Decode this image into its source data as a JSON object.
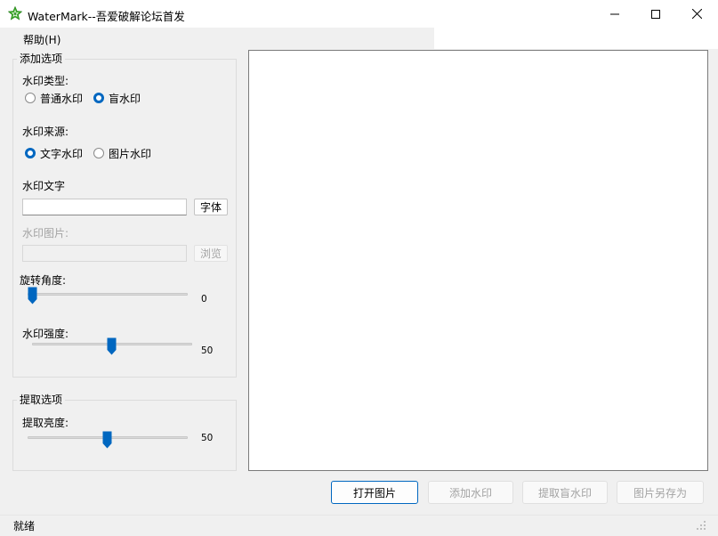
{
  "window": {
    "title": "WaterMark--吾爱破解论坛首发"
  },
  "menu": {
    "help": "帮助(H)"
  },
  "add_options": {
    "title": "添加选项",
    "type_label": "水印类型:",
    "type_options": [
      "普通水印",
      "盲水印"
    ],
    "type_selected": "盲水印",
    "source_label": "水印来源:",
    "source_options": [
      "文字水印",
      "图片水印"
    ],
    "source_selected": "文字水印",
    "text_label": "水印文字",
    "text_value": "",
    "font_button": "字体",
    "image_label": "水印图片:",
    "image_value": "",
    "browse_button": "浏览",
    "rotation_label": "旋转角度:",
    "rotation_value": "0",
    "rotation_min": 0,
    "rotation_max": 360,
    "strength_label": "水印强度:",
    "strength_value": "50",
    "strength_fraction": 0.5
  },
  "extract_options": {
    "title": "提取选项",
    "brightness_label": "提取亮度:",
    "brightness_value": "50",
    "brightness_fraction": 0.5
  },
  "actions": {
    "open_image": "打开图片",
    "add_watermark": "添加水印",
    "extract_blind": "提取盲水印",
    "save_as": "图片另存为"
  },
  "status": {
    "text": "就绪"
  },
  "colors": {
    "accent": "#0067c0",
    "disabled_text": "#a3a3a3"
  }
}
